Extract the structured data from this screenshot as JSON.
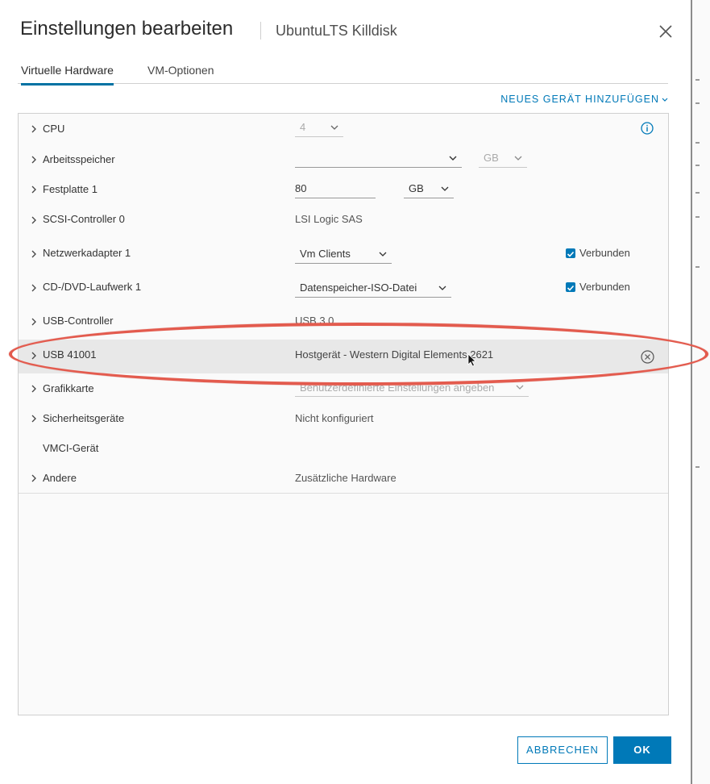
{
  "dialog": {
    "title": "Einstellungen bearbeiten",
    "vm_name": "UbuntuLTS Killdisk"
  },
  "tabs": [
    {
      "label": "Virtuelle Hardware",
      "active": true
    },
    {
      "label": "VM-Optionen",
      "active": false
    }
  ],
  "add_device_label": "NEUES GERÄT HINZUFÜGEN",
  "devices": {
    "cpu": {
      "label": "CPU",
      "value": "4"
    },
    "memory": {
      "label": "Arbeitsspeicher",
      "value": "",
      "unit": "GB"
    },
    "disk1": {
      "label": "Festplatte 1",
      "value": "80",
      "unit": "GB"
    },
    "scsi0": {
      "label": "SCSI-Controller 0",
      "value": "LSI Logic SAS"
    },
    "nic1": {
      "label": "Netzwerkadapter 1",
      "value": "Vm Clients",
      "connected_label": "Verbunden",
      "connected": true
    },
    "cddvd1": {
      "label": "CD-/DVD-Laufwerk 1",
      "value": "Datenspeicher-ISO-Datei",
      "connected_label": "Verbunden",
      "connected": true
    },
    "usb_controller": {
      "label": "USB-Controller",
      "value": "USB 3.0"
    },
    "usb_41001": {
      "label": "USB 41001",
      "value": "Hostgerät - Western Digital Elements 2621"
    },
    "video": {
      "label": "Grafikkarte",
      "value": "Benutzerdefinierte Einstellungen angeben"
    },
    "security": {
      "label": "Sicherheitsgeräte",
      "value": "Nicht konfiguriert"
    },
    "vmci": {
      "label": "VMCI-Gerät",
      "value": ""
    },
    "other": {
      "label": "Andere",
      "value": "Zusätzliche Hardware"
    }
  },
  "buttons": {
    "cancel": "ABBRECHEN",
    "ok": "OK"
  },
  "colors": {
    "accent": "#0079b8",
    "annotation": "#e35b4e",
    "selected_row": "#e8e8e8"
  },
  "icons": {
    "close": "close-icon",
    "info": "info-icon",
    "expand": "chevron-right-icon",
    "dropdown": "chevron-down-icon",
    "remove": "remove-circle-icon"
  }
}
